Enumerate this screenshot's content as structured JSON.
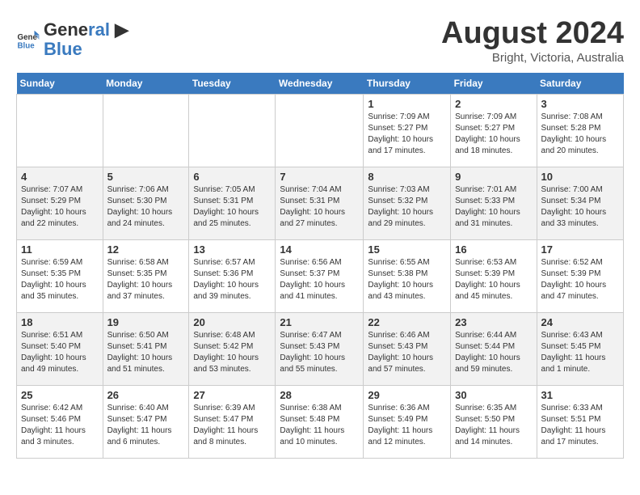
{
  "header": {
    "logo_general": "General",
    "logo_blue": "Blue",
    "month": "August 2024",
    "location": "Bright, Victoria, Australia"
  },
  "days_of_week": [
    "Sunday",
    "Monday",
    "Tuesday",
    "Wednesday",
    "Thursday",
    "Friday",
    "Saturday"
  ],
  "weeks": [
    [
      {
        "day": "",
        "info": ""
      },
      {
        "day": "",
        "info": ""
      },
      {
        "day": "",
        "info": ""
      },
      {
        "day": "",
        "info": ""
      },
      {
        "day": "1",
        "info": "Sunrise: 7:09 AM\nSunset: 5:27 PM\nDaylight: 10 hours\nand 17 minutes."
      },
      {
        "day": "2",
        "info": "Sunrise: 7:09 AM\nSunset: 5:27 PM\nDaylight: 10 hours\nand 18 minutes."
      },
      {
        "day": "3",
        "info": "Sunrise: 7:08 AM\nSunset: 5:28 PM\nDaylight: 10 hours\nand 20 minutes."
      }
    ],
    [
      {
        "day": "4",
        "info": "Sunrise: 7:07 AM\nSunset: 5:29 PM\nDaylight: 10 hours\nand 22 minutes."
      },
      {
        "day": "5",
        "info": "Sunrise: 7:06 AM\nSunset: 5:30 PM\nDaylight: 10 hours\nand 24 minutes."
      },
      {
        "day": "6",
        "info": "Sunrise: 7:05 AM\nSunset: 5:31 PM\nDaylight: 10 hours\nand 25 minutes."
      },
      {
        "day": "7",
        "info": "Sunrise: 7:04 AM\nSunset: 5:31 PM\nDaylight: 10 hours\nand 27 minutes."
      },
      {
        "day": "8",
        "info": "Sunrise: 7:03 AM\nSunset: 5:32 PM\nDaylight: 10 hours\nand 29 minutes."
      },
      {
        "day": "9",
        "info": "Sunrise: 7:01 AM\nSunset: 5:33 PM\nDaylight: 10 hours\nand 31 minutes."
      },
      {
        "day": "10",
        "info": "Sunrise: 7:00 AM\nSunset: 5:34 PM\nDaylight: 10 hours\nand 33 minutes."
      }
    ],
    [
      {
        "day": "11",
        "info": "Sunrise: 6:59 AM\nSunset: 5:35 PM\nDaylight: 10 hours\nand 35 minutes."
      },
      {
        "day": "12",
        "info": "Sunrise: 6:58 AM\nSunset: 5:35 PM\nDaylight: 10 hours\nand 37 minutes."
      },
      {
        "day": "13",
        "info": "Sunrise: 6:57 AM\nSunset: 5:36 PM\nDaylight: 10 hours\nand 39 minutes."
      },
      {
        "day": "14",
        "info": "Sunrise: 6:56 AM\nSunset: 5:37 PM\nDaylight: 10 hours\nand 41 minutes."
      },
      {
        "day": "15",
        "info": "Sunrise: 6:55 AM\nSunset: 5:38 PM\nDaylight: 10 hours\nand 43 minutes."
      },
      {
        "day": "16",
        "info": "Sunrise: 6:53 AM\nSunset: 5:39 PM\nDaylight: 10 hours\nand 45 minutes."
      },
      {
        "day": "17",
        "info": "Sunrise: 6:52 AM\nSunset: 5:39 PM\nDaylight: 10 hours\nand 47 minutes."
      }
    ],
    [
      {
        "day": "18",
        "info": "Sunrise: 6:51 AM\nSunset: 5:40 PM\nDaylight: 10 hours\nand 49 minutes."
      },
      {
        "day": "19",
        "info": "Sunrise: 6:50 AM\nSunset: 5:41 PM\nDaylight: 10 hours\nand 51 minutes."
      },
      {
        "day": "20",
        "info": "Sunrise: 6:48 AM\nSunset: 5:42 PM\nDaylight: 10 hours\nand 53 minutes."
      },
      {
        "day": "21",
        "info": "Sunrise: 6:47 AM\nSunset: 5:43 PM\nDaylight: 10 hours\nand 55 minutes."
      },
      {
        "day": "22",
        "info": "Sunrise: 6:46 AM\nSunset: 5:43 PM\nDaylight: 10 hours\nand 57 minutes."
      },
      {
        "day": "23",
        "info": "Sunrise: 6:44 AM\nSunset: 5:44 PM\nDaylight: 10 hours\nand 59 minutes."
      },
      {
        "day": "24",
        "info": "Sunrise: 6:43 AM\nSunset: 5:45 PM\nDaylight: 11 hours\nand 1 minute."
      }
    ],
    [
      {
        "day": "25",
        "info": "Sunrise: 6:42 AM\nSunset: 5:46 PM\nDaylight: 11 hours\nand 3 minutes."
      },
      {
        "day": "26",
        "info": "Sunrise: 6:40 AM\nSunset: 5:47 PM\nDaylight: 11 hours\nand 6 minutes."
      },
      {
        "day": "27",
        "info": "Sunrise: 6:39 AM\nSunset: 5:47 PM\nDaylight: 11 hours\nand 8 minutes."
      },
      {
        "day": "28",
        "info": "Sunrise: 6:38 AM\nSunset: 5:48 PM\nDaylight: 11 hours\nand 10 minutes."
      },
      {
        "day": "29",
        "info": "Sunrise: 6:36 AM\nSunset: 5:49 PM\nDaylight: 11 hours\nand 12 minutes."
      },
      {
        "day": "30",
        "info": "Sunrise: 6:35 AM\nSunset: 5:50 PM\nDaylight: 11 hours\nand 14 minutes."
      },
      {
        "day": "31",
        "info": "Sunrise: 6:33 AM\nSunset: 5:51 PM\nDaylight: 11 hours\nand 17 minutes."
      }
    ]
  ]
}
